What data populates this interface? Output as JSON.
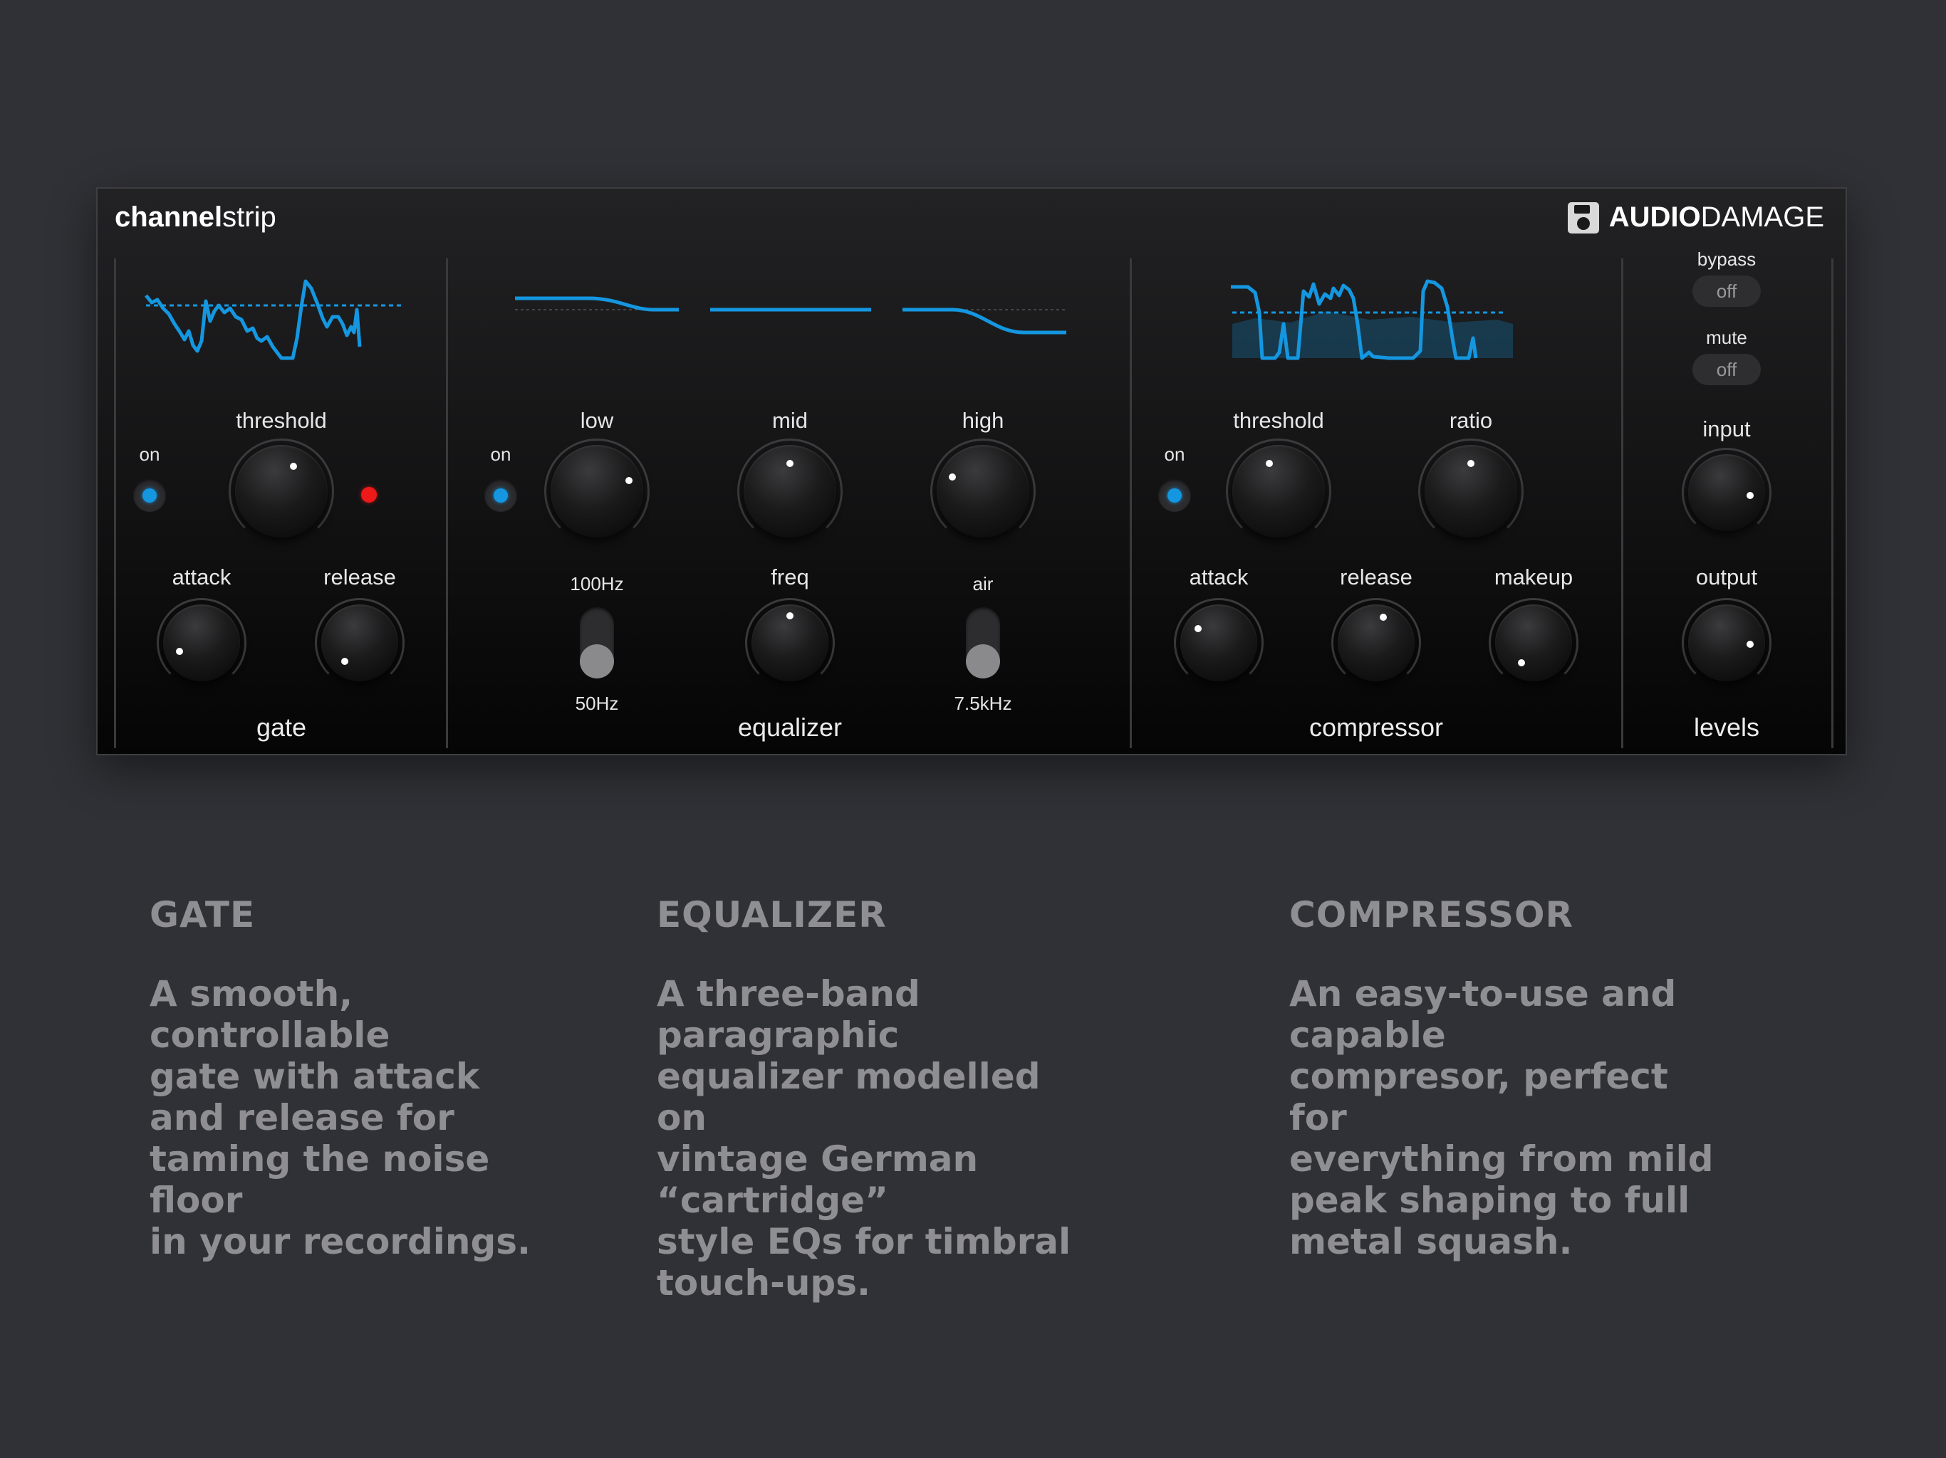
{
  "header": {
    "title_bold": "channel",
    "title_light": "strip",
    "brand_bold": "AUDIO",
    "brand_light": "DAMAGE",
    "brand_icon": "floppy-disk-icon"
  },
  "gate": {
    "on_label": "on",
    "threshold_label": "threshold",
    "attack_label": "attack",
    "release_label": "release",
    "section_label": "gate"
  },
  "equalizer": {
    "on_label": "on",
    "low_label": "low",
    "mid_label": "mid",
    "high_label": "high",
    "low_switch_top": "100Hz",
    "low_switch_bottom": "50Hz",
    "freq_label": "freq",
    "air_label": "air",
    "air_switch_bottom": "7.5kHz",
    "section_label": "equalizer"
  },
  "compressor": {
    "on_label": "on",
    "threshold_label": "threshold",
    "ratio_label": "ratio",
    "attack_label": "attack",
    "release_label": "release",
    "makeup_label": "makeup",
    "section_label": "compressor"
  },
  "levels": {
    "bypass_label": "bypass",
    "bypass_value": "off",
    "mute_label": "mute",
    "mute_value": "off",
    "input_label": "input",
    "output_label": "output",
    "section_label": "levels"
  },
  "colors": {
    "accent": "#1497e0",
    "gate_indicator": "#ee1a1a",
    "background": "#303136"
  },
  "descriptions": [
    {
      "title": "GATE",
      "body": "A smooth, controllable\ngate with attack\nand release for\ntaming the noise floor\nin your recordings."
    },
    {
      "title": "EQUALIZER",
      "body": "A three-band paragraphic\nequalizer modelled on\nvintage German “cartridge”\nstyle EQs for timbral\ntouch-ups."
    },
    {
      "title": "COMPRESSOR",
      "body": "An easy-to-use and capable\ncompresor, perfect for\neverything from mild\npeak shaping to full\nmetal squash."
    }
  ]
}
